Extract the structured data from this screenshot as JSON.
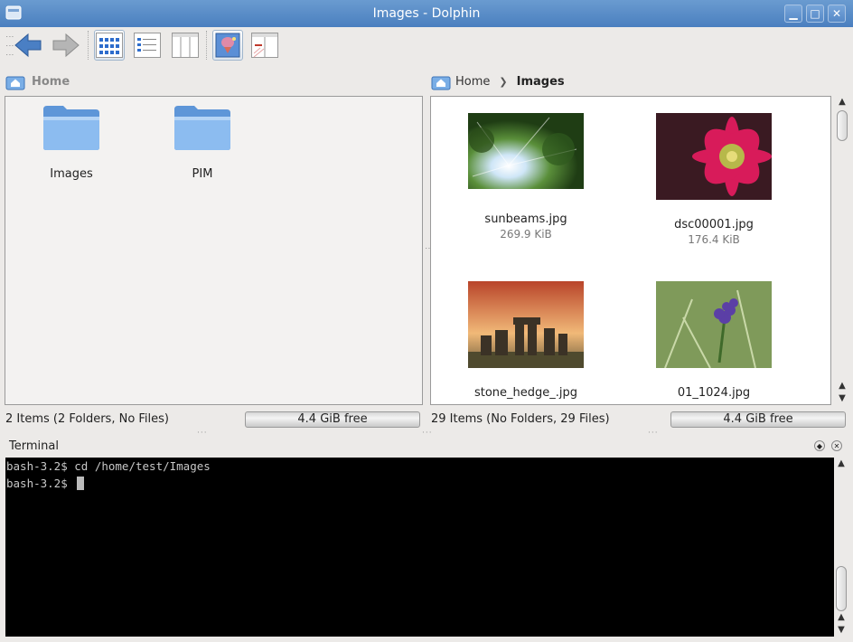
{
  "window": {
    "title": "Images - Dolphin",
    "minimize_icon": "minimize-icon",
    "maximize_icon": "maximize-icon",
    "close_icon": "close-icon"
  },
  "toolbar": {
    "buttons": [
      {
        "name": "back",
        "icon": "back-arrow-icon"
      },
      {
        "name": "forward",
        "icon": "forward-arrow-icon"
      },
      {
        "name": "icons-view",
        "icon": "icons-view-icon",
        "active": true
      },
      {
        "name": "details-view",
        "icon": "details-view-icon"
      },
      {
        "name": "columns-view",
        "icon": "columns-view-icon"
      },
      {
        "name": "preview",
        "icon": "preview-icon",
        "active": true
      },
      {
        "name": "split",
        "icon": "split-view-icon"
      }
    ]
  },
  "left_pane": {
    "breadcrumb": [
      "Home"
    ],
    "folders": [
      {
        "name": "Images"
      },
      {
        "name": "PIM"
      }
    ],
    "status": "2 Items (2 Folders, No Files)",
    "free_space": "4.4 GiB free"
  },
  "right_pane": {
    "breadcrumb": [
      "Home",
      "Images"
    ],
    "files": [
      {
        "name": "sunbeams.jpg",
        "size": "269.9 KiB"
      },
      {
        "name": "dsc00001.jpg",
        "size": "176.4 KiB"
      },
      {
        "name": "stone_hedge_.jpg",
        "size": ""
      },
      {
        "name": "01_1024.jpg",
        "size": ""
      }
    ],
    "status": "29 Items (No Folders, 29 Files)",
    "free_space": "4.4 GiB free"
  },
  "terminal": {
    "title": "Terminal",
    "lines": [
      "bash-3.2$ cd /home/test/Images",
      "bash-3.2$ "
    ]
  },
  "colors": {
    "titlebar": "#4a7fbf",
    "folder": "#7aaee6",
    "terminal_bg": "#000000"
  }
}
